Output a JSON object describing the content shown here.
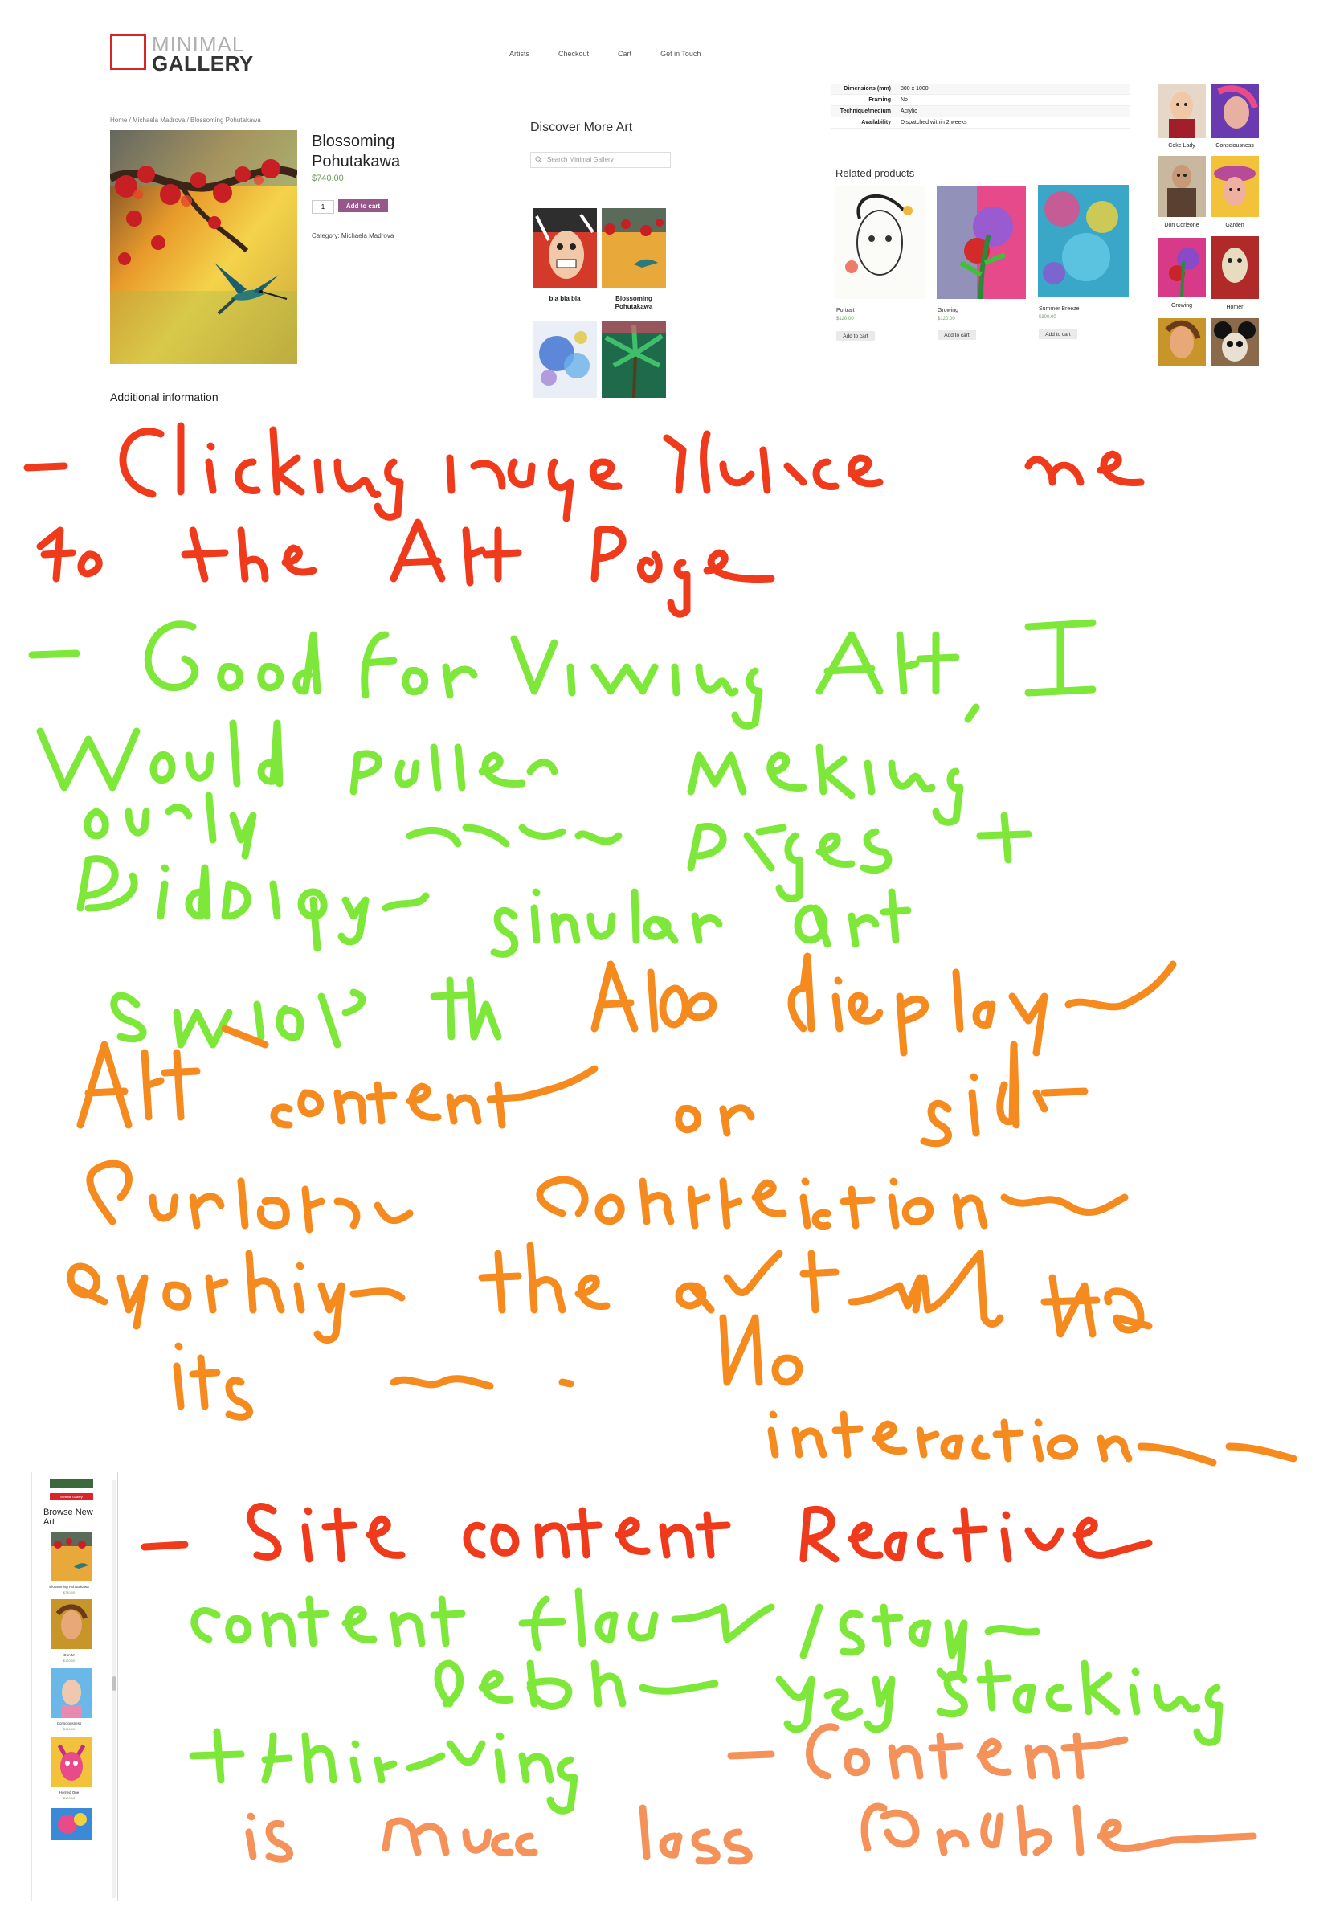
{
  "product_page": {
    "logo": {
      "line1": "MINIMAL",
      "line2": "GALLERY"
    },
    "nav": [
      "Artists",
      "Checkout",
      "Cart",
      "Get in Touch"
    ],
    "breadcrumb": "Home / Michaela Madrova / Blossoming Pohutakawa",
    "product": {
      "title": "Blossoming Pohutakawa",
      "price": "$740.00",
      "quantity": "1",
      "add_to_cart": "Add to cart",
      "category": "Category: Michaela Madrova"
    },
    "additional_information_heading": "Additional information",
    "discover": {
      "title": "Discover More Art",
      "search_placeholder": "Search Minimal Gallery",
      "items": [
        {
          "name": "bla bla bla"
        },
        {
          "name": "Blossoming Pohutakawa"
        }
      ]
    },
    "attributes": [
      {
        "label": "Dimensions (mm)",
        "value": "800 x 1000"
      },
      {
        "label": "Framing",
        "value": "No"
      },
      {
        "label": "Technique/medium",
        "value": "Acrylic"
      },
      {
        "label": "Availability",
        "value": "Dispatched within 2 weeks"
      }
    ],
    "related": {
      "title": "Related products",
      "items": [
        {
          "name": "Portrait",
          "price": "$120.00",
          "button": "Add to cart"
        },
        {
          "name": "Growing",
          "price": "$120.00",
          "button": "Add to cart"
        },
        {
          "name": "Summer Breeze",
          "price": "$300.00",
          "button": "Add to cart"
        }
      ]
    },
    "sidebar_art": [
      "Coke Lady",
      "Consciousness",
      "Don Corleone",
      "Garden",
      "Growing",
      "Homer"
    ]
  },
  "mobile_page": {
    "top_bar_label": "Minimal Gallery",
    "title": "Browse New Art",
    "items": [
      {
        "name": "Blossoming Pohutakawa",
        "price": "$740.00"
      },
      {
        "name": "Don M",
        "price": "$120.00"
      },
      {
        "name": "Consciousness",
        "price": "$140.00"
      },
      {
        "name": "Horned One",
        "price": "$120.00"
      }
    ]
  },
  "notes": {
    "ink_colors": {
      "red": "#ef3b1c",
      "green": "#7ee83a",
      "orange": "#f58a1f",
      "light_orange": "#f4925a"
    }
  }
}
